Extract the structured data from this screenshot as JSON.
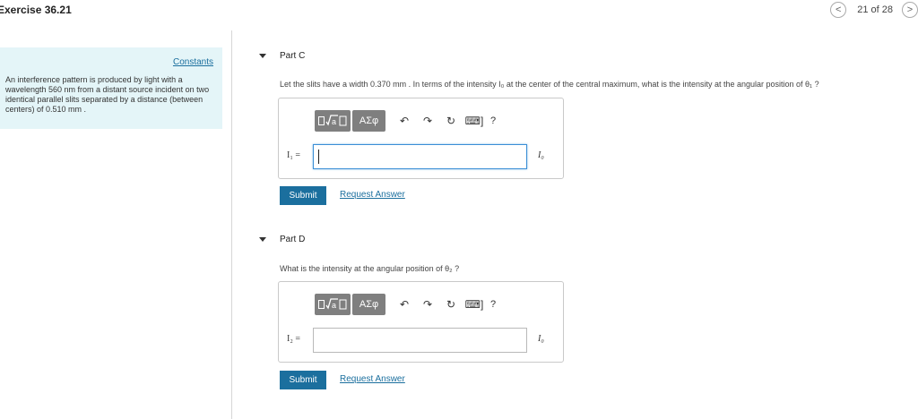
{
  "header": {
    "title": "Exercise 36.21",
    "nav": {
      "prev": "<",
      "count": "21 of 28",
      "next": ">"
    }
  },
  "sidebar": {
    "constants_link": "Constants",
    "problem_text": "An interference pattern is produced by light with a wavelength 560 nm from a distant source incident on two identical parallel slits separated by a distance (between centers) of 0.510 mm ."
  },
  "toolbar": {
    "greek_label": "ΑΣφ",
    "undo_icon": "↶",
    "redo_icon": "↷",
    "reset_icon": "↻",
    "keyboard_label": "⌨]",
    "help_label": "?"
  },
  "parts": {
    "c": {
      "title": "Part C",
      "question": "Let the slits have a width 0.370 mm . In terms of the intensity I₀ at the center of the central maximum, what is the intensity at the angular position of θ₁ ?",
      "var_label": "I₁ =",
      "answer_value": "",
      "unit": "I₀",
      "submit_label": "Submit",
      "request_label": "Request Answer"
    },
    "d": {
      "title": "Part D",
      "question": "What is the intensity at the angular position of θ₂ ?",
      "var_label": "I₂ =",
      "answer_value": "",
      "unit": "I₀",
      "submit_label": "Submit",
      "request_label": "Request Answer"
    }
  }
}
